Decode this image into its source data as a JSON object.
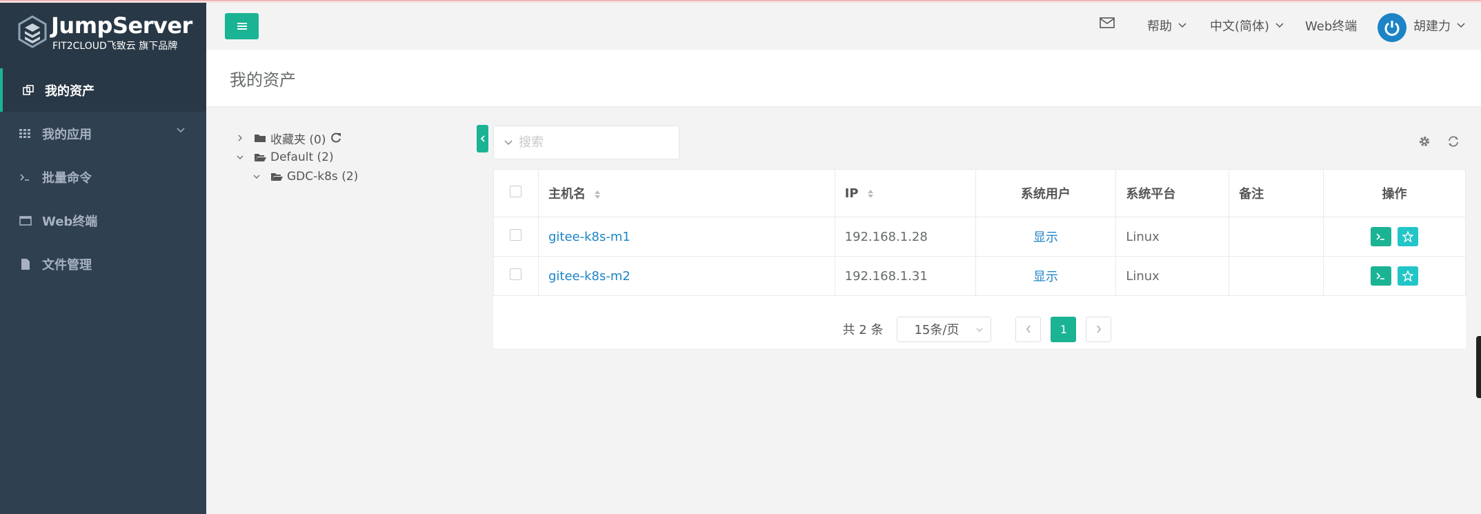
{
  "brand": {
    "title": "JumpServer",
    "subtitle": "FIT2CLOUD飞致云 旗下品牌"
  },
  "sidebar": {
    "items": [
      {
        "label": "我的资产",
        "icon": "assets-icon",
        "active": true
      },
      {
        "label": "我的应用",
        "icon": "grid-icon",
        "has_caret": true
      },
      {
        "label": "批量命令",
        "icon": "terminal-icon"
      },
      {
        "label": "Web终端",
        "icon": "window-icon"
      },
      {
        "label": "文件管理",
        "icon": "file-icon"
      }
    ]
  },
  "topbar": {
    "help": "帮助",
    "language": "中文(简体)",
    "web_terminal": "Web终端",
    "user": "胡建力"
  },
  "page": {
    "title": "我的资产"
  },
  "tree": {
    "favorites": "收藏夹 (0)",
    "default": "Default (2)",
    "child": "GDC-k8s (2)"
  },
  "search": {
    "placeholder": "搜索"
  },
  "table": {
    "headers": {
      "hostname": "主机名",
      "ip": "IP",
      "system_user": "系统用户",
      "platform": "系统平台",
      "comment": "备注",
      "actions": "操作"
    },
    "rows": [
      {
        "hostname": "gitee-k8s-m1",
        "ip": "192.168.1.28",
        "system_user": "显示",
        "platform": "Linux",
        "comment": ""
      },
      {
        "hostname": "gitee-k8s-m2",
        "ip": "192.168.1.31",
        "system_user": "显示",
        "platform": "Linux",
        "comment": ""
      }
    ]
  },
  "pagination": {
    "total": "共 2 条",
    "page_size": "15条/页",
    "current_page": "1"
  },
  "colors": {
    "sidebar": "#2f4050",
    "accent": "#1ab394",
    "link": "#1c84c6",
    "cyan": "#23c6c8"
  }
}
